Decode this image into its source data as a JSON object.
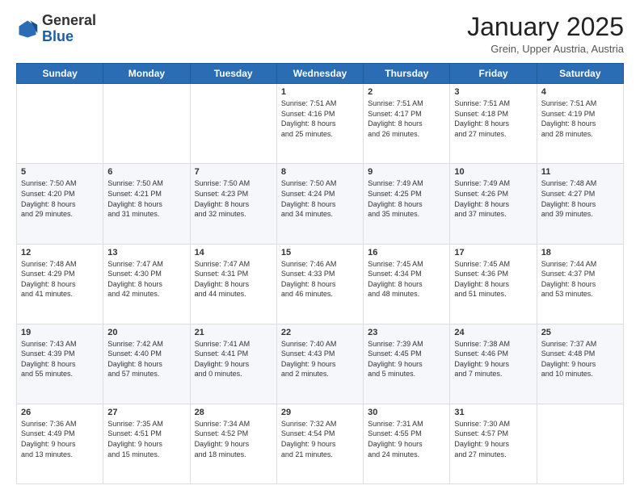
{
  "header": {
    "logo_general": "General",
    "logo_blue": "Blue",
    "month_title": "January 2025",
    "location": "Grein, Upper Austria, Austria"
  },
  "days_of_week": [
    "Sunday",
    "Monday",
    "Tuesday",
    "Wednesday",
    "Thursday",
    "Friday",
    "Saturday"
  ],
  "weeks": [
    [
      {
        "day": "",
        "data": ""
      },
      {
        "day": "",
        "data": ""
      },
      {
        "day": "",
        "data": ""
      },
      {
        "day": "1",
        "data": "Sunrise: 7:51 AM\nSunset: 4:16 PM\nDaylight: 8 hours\nand 25 minutes."
      },
      {
        "day": "2",
        "data": "Sunrise: 7:51 AM\nSunset: 4:17 PM\nDaylight: 8 hours\nand 26 minutes."
      },
      {
        "day": "3",
        "data": "Sunrise: 7:51 AM\nSunset: 4:18 PM\nDaylight: 8 hours\nand 27 minutes."
      },
      {
        "day": "4",
        "data": "Sunrise: 7:51 AM\nSunset: 4:19 PM\nDaylight: 8 hours\nand 28 minutes."
      }
    ],
    [
      {
        "day": "5",
        "data": "Sunrise: 7:50 AM\nSunset: 4:20 PM\nDaylight: 8 hours\nand 29 minutes."
      },
      {
        "day": "6",
        "data": "Sunrise: 7:50 AM\nSunset: 4:21 PM\nDaylight: 8 hours\nand 31 minutes."
      },
      {
        "day": "7",
        "data": "Sunrise: 7:50 AM\nSunset: 4:23 PM\nDaylight: 8 hours\nand 32 minutes."
      },
      {
        "day": "8",
        "data": "Sunrise: 7:50 AM\nSunset: 4:24 PM\nDaylight: 8 hours\nand 34 minutes."
      },
      {
        "day": "9",
        "data": "Sunrise: 7:49 AM\nSunset: 4:25 PM\nDaylight: 8 hours\nand 35 minutes."
      },
      {
        "day": "10",
        "data": "Sunrise: 7:49 AM\nSunset: 4:26 PM\nDaylight: 8 hours\nand 37 minutes."
      },
      {
        "day": "11",
        "data": "Sunrise: 7:48 AM\nSunset: 4:27 PM\nDaylight: 8 hours\nand 39 minutes."
      }
    ],
    [
      {
        "day": "12",
        "data": "Sunrise: 7:48 AM\nSunset: 4:29 PM\nDaylight: 8 hours\nand 41 minutes."
      },
      {
        "day": "13",
        "data": "Sunrise: 7:47 AM\nSunset: 4:30 PM\nDaylight: 8 hours\nand 42 minutes."
      },
      {
        "day": "14",
        "data": "Sunrise: 7:47 AM\nSunset: 4:31 PM\nDaylight: 8 hours\nand 44 minutes."
      },
      {
        "day": "15",
        "data": "Sunrise: 7:46 AM\nSunset: 4:33 PM\nDaylight: 8 hours\nand 46 minutes."
      },
      {
        "day": "16",
        "data": "Sunrise: 7:45 AM\nSunset: 4:34 PM\nDaylight: 8 hours\nand 48 minutes."
      },
      {
        "day": "17",
        "data": "Sunrise: 7:45 AM\nSunset: 4:36 PM\nDaylight: 8 hours\nand 51 minutes."
      },
      {
        "day": "18",
        "data": "Sunrise: 7:44 AM\nSunset: 4:37 PM\nDaylight: 8 hours\nand 53 minutes."
      }
    ],
    [
      {
        "day": "19",
        "data": "Sunrise: 7:43 AM\nSunset: 4:39 PM\nDaylight: 8 hours\nand 55 minutes."
      },
      {
        "day": "20",
        "data": "Sunrise: 7:42 AM\nSunset: 4:40 PM\nDaylight: 8 hours\nand 57 minutes."
      },
      {
        "day": "21",
        "data": "Sunrise: 7:41 AM\nSunset: 4:41 PM\nDaylight: 9 hours\nand 0 minutes."
      },
      {
        "day": "22",
        "data": "Sunrise: 7:40 AM\nSunset: 4:43 PM\nDaylight: 9 hours\nand 2 minutes."
      },
      {
        "day": "23",
        "data": "Sunrise: 7:39 AM\nSunset: 4:45 PM\nDaylight: 9 hours\nand 5 minutes."
      },
      {
        "day": "24",
        "data": "Sunrise: 7:38 AM\nSunset: 4:46 PM\nDaylight: 9 hours\nand 7 minutes."
      },
      {
        "day": "25",
        "data": "Sunrise: 7:37 AM\nSunset: 4:48 PM\nDaylight: 9 hours\nand 10 minutes."
      }
    ],
    [
      {
        "day": "26",
        "data": "Sunrise: 7:36 AM\nSunset: 4:49 PM\nDaylight: 9 hours\nand 13 minutes."
      },
      {
        "day": "27",
        "data": "Sunrise: 7:35 AM\nSunset: 4:51 PM\nDaylight: 9 hours\nand 15 minutes."
      },
      {
        "day": "28",
        "data": "Sunrise: 7:34 AM\nSunset: 4:52 PM\nDaylight: 9 hours\nand 18 minutes."
      },
      {
        "day": "29",
        "data": "Sunrise: 7:32 AM\nSunset: 4:54 PM\nDaylight: 9 hours\nand 21 minutes."
      },
      {
        "day": "30",
        "data": "Sunrise: 7:31 AM\nSunset: 4:55 PM\nDaylight: 9 hours\nand 24 minutes."
      },
      {
        "day": "31",
        "data": "Sunrise: 7:30 AM\nSunset: 4:57 PM\nDaylight: 9 hours\nand 27 minutes."
      },
      {
        "day": "",
        "data": ""
      }
    ]
  ]
}
